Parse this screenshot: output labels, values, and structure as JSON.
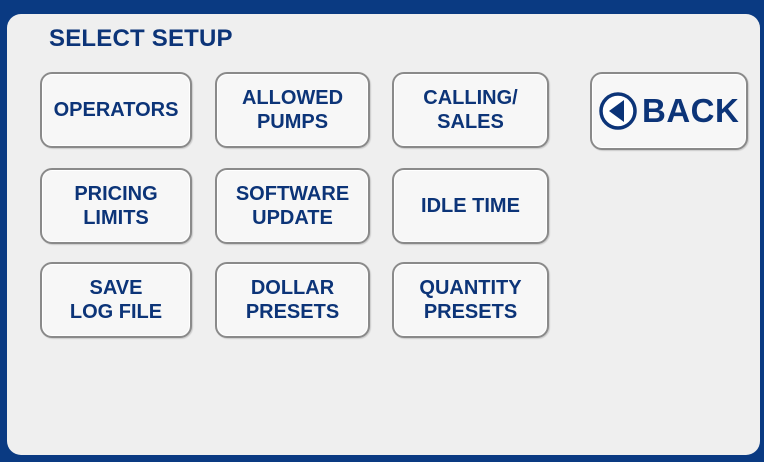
{
  "header": {
    "title": "SELECT SETUP"
  },
  "buttons": {
    "operators": "OPERATORS",
    "allowed_pumps": "ALLOWED\nPUMPS",
    "calling_sales": "CALLING/\nSALES",
    "pricing_limits": "PRICING\nLIMITS",
    "software_update": "SOFTWARE\nUPDATE",
    "idle_time": "IDLE TIME",
    "save_log_file": "SAVE\nLOG FILE",
    "dollar_presets": "DOLLAR\nPRESETS",
    "quantity_presets": "QUANTITY\nPRESETS"
  },
  "back": {
    "label": "BACK",
    "icon": "back-arrow-circle-icon"
  },
  "colors": {
    "frame": "#0a3a82",
    "panel": "#efefef",
    "text": "#0c3478",
    "button_border": "#8a8a8a"
  }
}
